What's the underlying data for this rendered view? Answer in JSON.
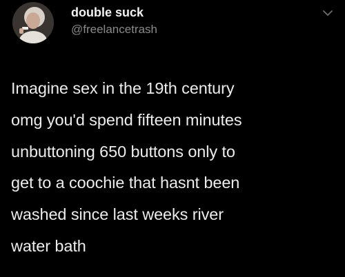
{
  "user": {
    "display_name": "double suck",
    "handle": "@freelancetrash",
    "avatar_icon": "profile-photo"
  },
  "menu": {
    "icon": "chevron-down-icon"
  },
  "tweet": {
    "text": "Imagine sex in the 19th century\nomg you'd spend fifteen minutes\nunbuttoning 650 buttons only to\nget to a coochie that hasnt been\nwashed since last weeks river\nwater bath"
  },
  "colors": {
    "background": "#000000",
    "name": "#f2f2f2",
    "handle": "#8a8a8a",
    "text": "#ececec"
  }
}
